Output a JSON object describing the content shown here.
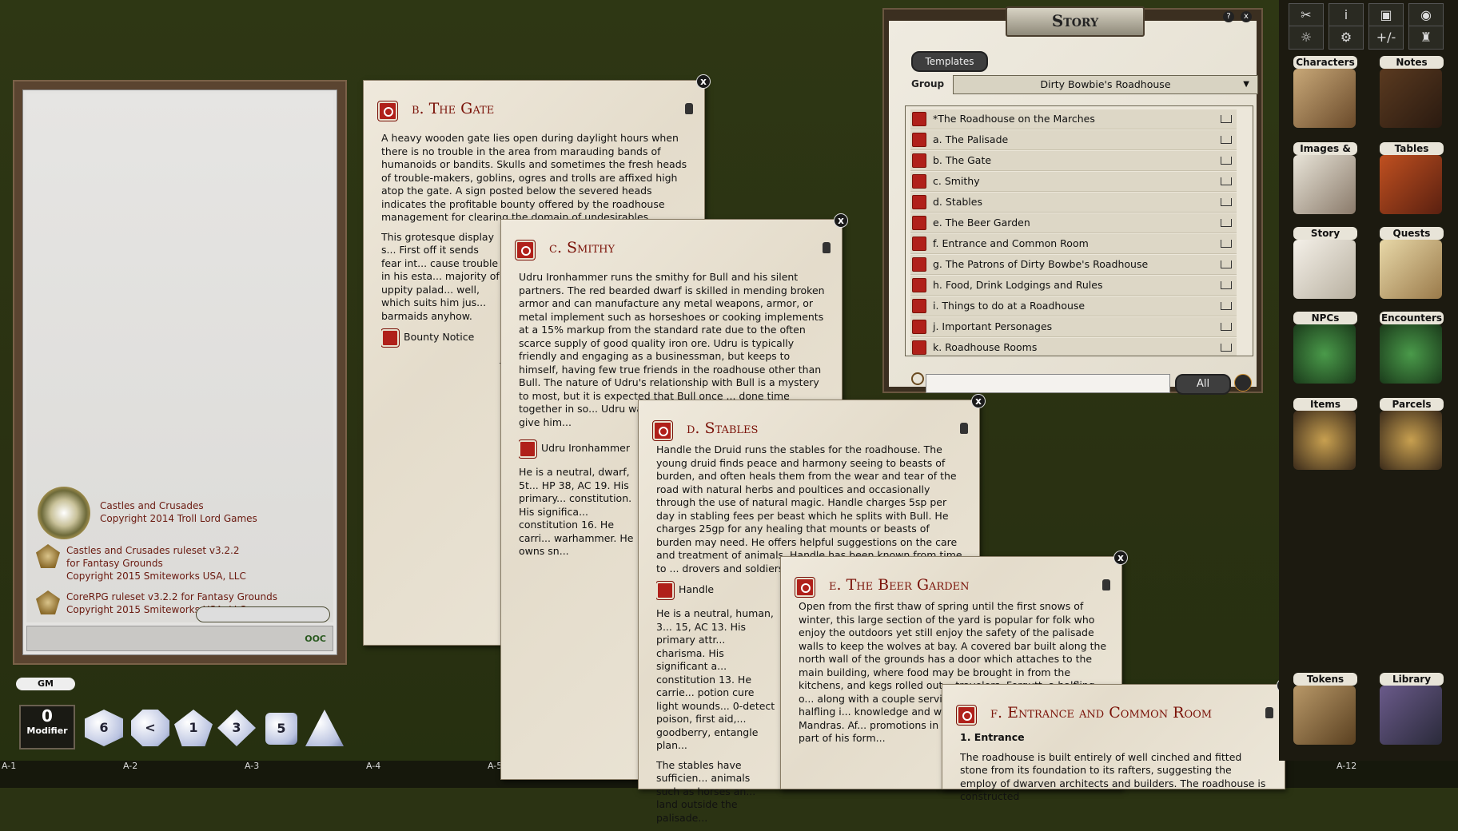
{
  "chat": {
    "credits": [
      {
        "line1": "Castles and Crusades",
        "line2": "Copyright 2014 Troll Lord Games"
      },
      {
        "line1": "Castles and Crusades ruleset v3.2.2",
        "line2": "for Fantasy Grounds",
        "line3": "Copyright 2015 Smiteworks USA, LLC"
      },
      {
        "line1": "CoreRPG ruleset v3.2.2 for Fantasy Grounds",
        "line2": "Copyright 2015 Smiteworks USA, LLC"
      }
    ],
    "ooc_label": "OOC"
  },
  "gm_label": "GM",
  "modifier": {
    "value": "0",
    "label": "Modifier"
  },
  "dice": [
    "6",
    "<",
    "1",
    "3",
    "5"
  ],
  "hotkeys": [
    "A-1",
    "A-2",
    "A-3",
    "A-4",
    "A-5",
    "A-12"
  ],
  "windows": {
    "gate": {
      "title": "b. The Gate",
      "p1": "A heavy wooden gate lies open during daylight hours when there is no trouble in the area from marauding bands of humanoids or bandits. Skulls and sometimes the fresh heads of trouble-makers, goblins, ogres and trolls are affixed high atop the gate. A sign posted below the severed heads indicates the profitable bounty offered by the roadhouse management for clearing the domain of undesirables.",
      "p2": "This grotesque display s... First off it sends fear int... cause trouble in his esta... majority of uppity palad... well, which suits him jus... barmaids anyhow.",
      "link": "Bounty Notice"
    },
    "smithy": {
      "title": "c. Smithy",
      "p1": "Udru Ironhammer runs the smithy for Bull and his silent partners. The red bearded dwarf is skilled in mending broken armor and can manufacture any metal weapons, armor, or metal implement such as horseshoes or cooking implements at a 15% markup from the standard rate due to the often scarce supply of good quality iron ore. Udru is typically friendly and engaging as a businessman, but keeps to himself, having few true friends in the roadhouse other than Bull. The nature of Udru's relationship with Bull is a mystery to most, but it is expected that Bull once ... done time together in so... Udru was wanted in fore... only Bull would give him...",
      "link": "Udru Ironhammer",
      "p2": "He is a neutral, dwarf, 5t... HP 38, AC 19. His primary... constitution. His significa... constitution 16. He carri... warhammer. He owns sn..."
    },
    "stables": {
      "title": "d. Stables",
      "p1": "Handle the Druid runs the stables for the roadhouse. The young druid finds peace and harmony seeing to beasts of burden, and often heals them from the wear and tear of the road with natural herbs and poultices and occasionally through the use of natural magic. Handle charges 5sp per day in stabling fees per beast which he splits with Bull. He charges 25gp for any healing that mounts or beasts of burden may need. He offers helpful suggestions on the care and treatment of animals. Handle has been known from time to ... drovers and soldiers who... above letting them know...",
      "link": "Handle",
      "p2": "He is a neutral, human, 3... 15, AC 13. His primary attr... charisma. His significant a... constitution 13. He carrie... potion cure light wounds... 0-detect poison, first aid,... goodberry, entangle plan...",
      "p3": "The stables have sufficien... animals such as horses an... land outside the palisade..."
    },
    "beer": {
      "title": "e. The Beer Garden",
      "p1": "Open from the first thaw of spring until the first snows of winter, this large section of the yard is popular for folk who enjoy the outdoors yet still enjoy the safety of the palisade walls to keep the wolves at bay. A covered bar built along the north wall of the grounds has a door which attaches to the main building, where food may be brought in from the kitchens, and kegs rolled out... travelers. Forgutt, a halfling o... along with a couple serving m... employ. The chubby halfling i... knowledge and was once a le... Alley Gang in Dro Mandras. Af... promotions in the guild due t... racism on the part of his form..."
    },
    "entrance": {
      "title": "f. Entrance and Common Room",
      "subhead": "1. Entrance",
      "p1": "The roadhouse is built entirely of well cinched and fitted stone from its foundation to its rafters, suggesting the employ of dwarven architects and builders. The roadhouse is constructed"
    }
  },
  "story": {
    "title": "Story",
    "templates_label": "Templates",
    "group_label": "Group",
    "group_value": "Dirty Bowbie's Roadhouse",
    "entries": [
      "*The Roadhouse on the Marches",
      "a. The Palisade",
      "b. The Gate",
      "c. Smithy",
      "d. Stables",
      "e. The Beer Garden",
      "f. Entrance and Common Room",
      "g. The Patrons of Dirty Bowbe's Roadhouse",
      "h. Food, Drink Lodgings and Rules",
      "i. Things to do at a Roadhouse",
      "j. Important Personages",
      "k. Roadhouse Rooms"
    ],
    "search_placeholder": "",
    "all_label": "All"
  },
  "sidebar": {
    "tools_row1": [
      "✂",
      "i",
      "▣",
      "◉"
    ],
    "tools_row2": [
      "☼",
      "⚙",
      "+/-",
      "♜"
    ],
    "library": [
      "Characters",
      "Notes",
      "Images & Maps",
      "Tables",
      "Story",
      "Quests",
      "NPCs",
      "Encounters",
      "Items",
      "Parcels",
      "Tokens",
      "Library"
    ]
  }
}
